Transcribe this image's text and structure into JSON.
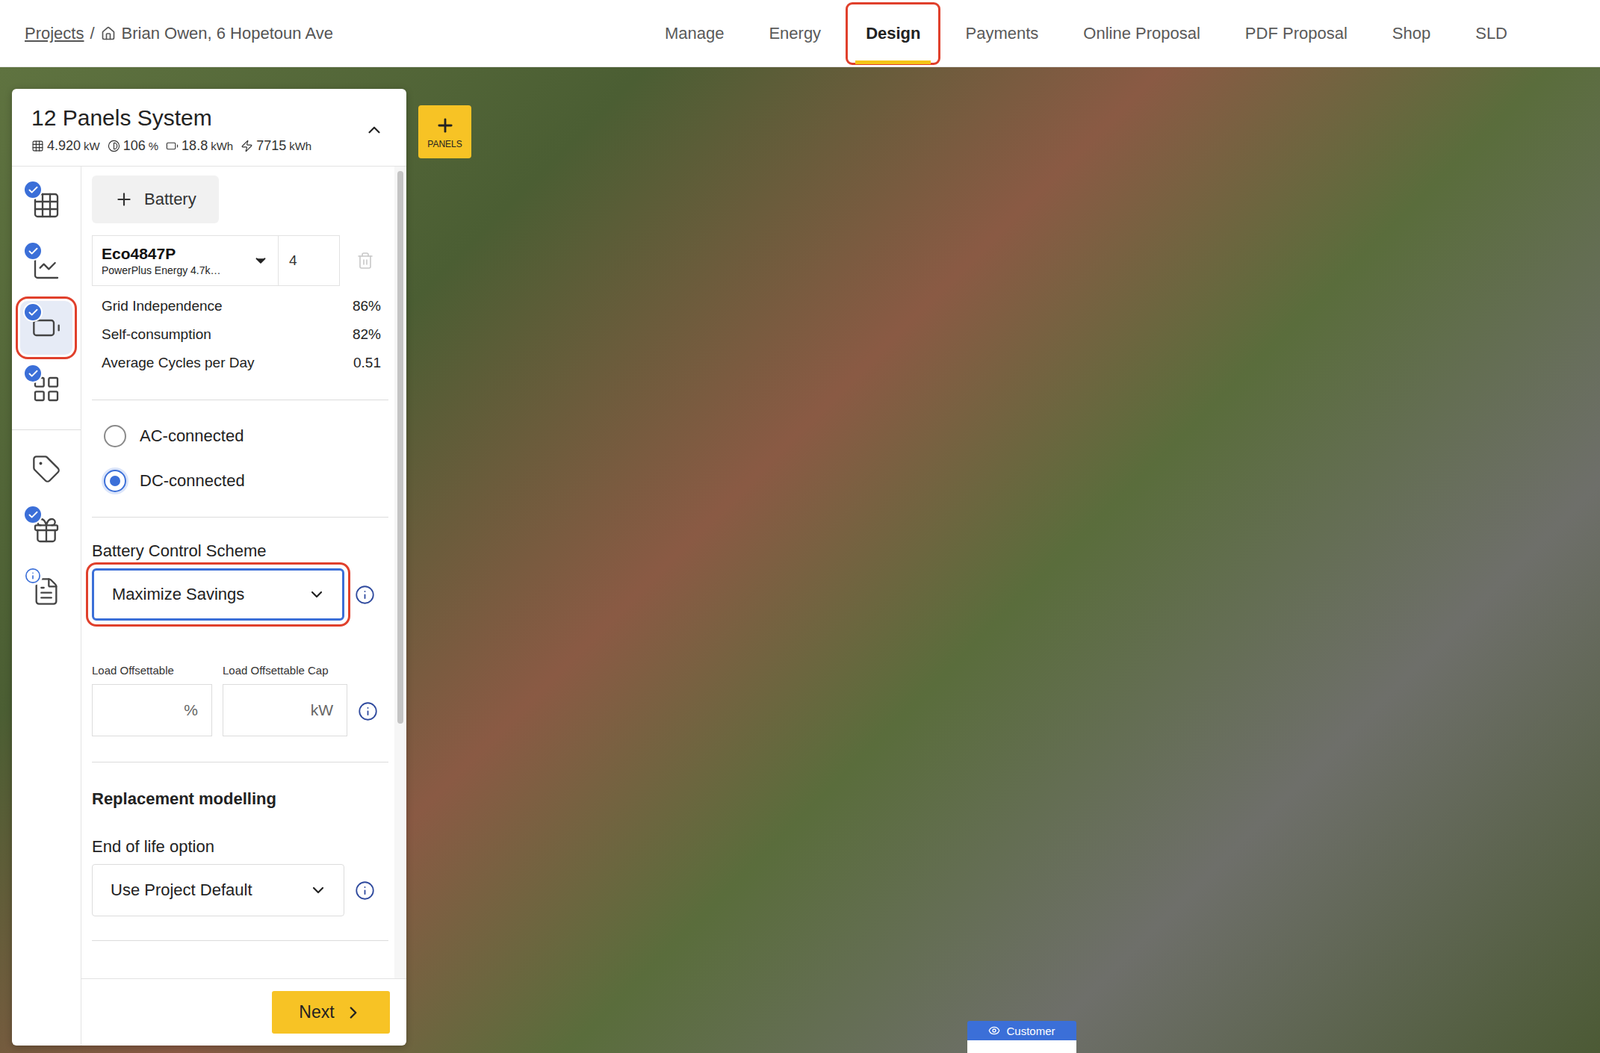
{
  "breadcrumb": {
    "root": "Projects",
    "separator": "/",
    "project": "Brian Owen, 6 Hopetoun Ave"
  },
  "tabs": [
    {
      "label": "Manage",
      "selected": false,
      "annotated": false
    },
    {
      "label": "Energy",
      "selected": false,
      "annotated": false
    },
    {
      "label": "Design",
      "selected": true,
      "annotated": true
    },
    {
      "label": "Payments",
      "selected": false,
      "annotated": false
    },
    {
      "label": "Online Proposal",
      "selected": false,
      "annotated": false
    },
    {
      "label": "PDF Proposal",
      "selected": false,
      "annotated": false
    },
    {
      "label": "Shop",
      "selected": false,
      "annotated": false
    },
    {
      "label": "SLD",
      "selected": false,
      "annotated": false
    }
  ],
  "map": {
    "add_button": {
      "label": "PANELS"
    },
    "view_badge": {
      "label": "Customer"
    }
  },
  "system": {
    "title": "12 Panels System",
    "expanded": true,
    "stats": [
      {
        "value": "4.920",
        "unit": "kW"
      },
      {
        "value": "106",
        "unit": "%"
      },
      {
        "value": "18.8",
        "unit": "kWh"
      },
      {
        "value": "7715",
        "unit": "kWh"
      }
    ]
  },
  "rail": {
    "top": [
      {
        "kind": "checked",
        "selected": false,
        "annotated": false
      },
      {
        "kind": "checked",
        "selected": false,
        "annotated": false
      },
      {
        "kind": "checked",
        "selected": true,
        "annotated": true
      },
      {
        "kind": "checked",
        "selected": false,
        "annotated": false
      }
    ],
    "bottom": [
      {
        "kind": "plain",
        "selected": false,
        "annotated": false
      },
      {
        "kind": "checked",
        "selected": false,
        "annotated": false
      },
      {
        "kind": "info",
        "selected": false,
        "annotated": false
      }
    ]
  },
  "battery": {
    "add_button": "Battery",
    "model": "Eco4847P",
    "maker": "PowerPlus Energy 4.7k…",
    "quantity": "4",
    "stats": [
      {
        "label": "Grid Independence",
        "value": "86%"
      },
      {
        "label": "Self-consumption",
        "value": "82%"
      },
      {
        "label": "Average Cycles per Day",
        "value": "0.51"
      }
    ],
    "connection": [
      {
        "label": "AC-connected",
        "selected": false
      },
      {
        "label": "DC-connected",
        "selected": true
      }
    ],
    "control_scheme": {
      "label": "Battery Control Scheme",
      "value": "Maximize Savings",
      "annotated": true,
      "focused": true
    },
    "load": [
      {
        "label": "Load Offsettable",
        "unit": "%"
      },
      {
        "label": "Load Offsettable Cap",
        "unit": "kW"
      }
    ],
    "replacement": {
      "title": "Replacement modelling",
      "label": "End of life option",
      "value": "Use Project Default"
    }
  },
  "footer": {
    "next": "Next"
  }
}
